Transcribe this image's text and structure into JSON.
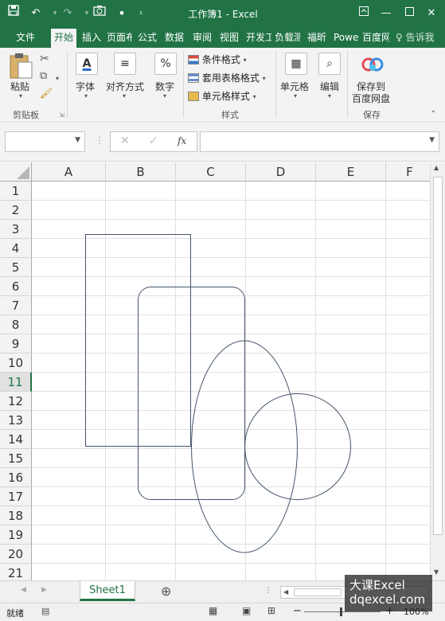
{
  "titlebar": {
    "title": "工作簿1 - Excel",
    "icons": [
      "save-icon",
      "undo-icon",
      "redo-icon",
      "camera-icon",
      "touch-mode-icon",
      "customize-icon",
      "ribbon-display-icon",
      "minimize-icon",
      "restore-icon",
      "close-icon"
    ]
  },
  "tabs": [
    "文件",
    "开始",
    "插入",
    "页面布局",
    "公式",
    "数据",
    "审阅",
    "视图",
    "开发工具",
    "负载测试",
    "福昕",
    "Power",
    "百度网盘",
    "告诉我"
  ],
  "ribbon": {
    "paste": "粘贴",
    "clipboard_group": "剪贴板",
    "font": "字体",
    "alignment": "对齐方式",
    "number": "数字",
    "conditional_format": "条件格式",
    "table_format": "套用表格格式",
    "cell_styles": "单元格样式",
    "styles_group": "样式",
    "cells": "单元格",
    "editing": "编辑",
    "save_to_baidu": "保存到",
    "save_to_baidu_line2": "百度网盘",
    "save_group": "保存"
  },
  "formula_bar": {
    "name_box": "",
    "fx": "fx",
    "cancel": "✕",
    "enter": "✓",
    "formula": ""
  },
  "grid": {
    "columns": [
      "A",
      "B",
      "C",
      "D",
      "E",
      "F"
    ],
    "rows": [
      "1",
      "2",
      "3",
      "4",
      "5",
      "6",
      "7",
      "8",
      "9",
      "10",
      "11",
      "12",
      "13",
      "14",
      "15",
      "16",
      "17",
      "18",
      "19",
      "20",
      "21"
    ],
    "selected_row": "11"
  },
  "shapes": [
    "rectangle",
    "rounded-rectangle",
    "ellipse",
    "circle"
  ],
  "shape_color": "#44546a",
  "sheets": {
    "active": "Sheet1",
    "add": "⊕"
  },
  "status": {
    "ready": "就绪",
    "zoom": "100%",
    "zoom_minus": "−",
    "zoom_plus": "+"
  },
  "watermark": {
    "line1": "大课Excel",
    "line2": "dqexcel.com"
  },
  "colors": {
    "excel_green": "#217346",
    "ribbon_bg": "#f3f3f3"
  }
}
